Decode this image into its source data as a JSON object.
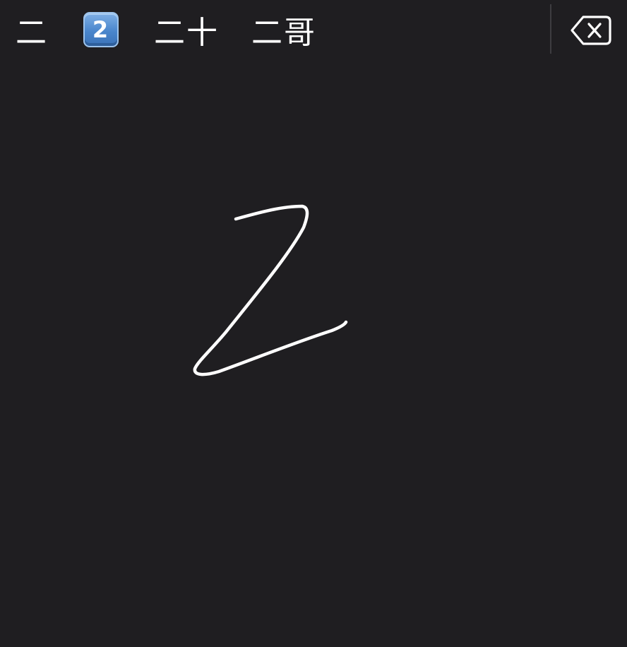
{
  "candidates": [
    {
      "text": "二"
    },
    {
      "text": "2",
      "kind": "keycap-digit-emoji"
    },
    {
      "text": "二十"
    },
    {
      "text": "二哥"
    }
  ],
  "icons": {
    "delete": "backspace-delete-icon"
  },
  "colors": {
    "background": "#1f1e21",
    "ink": "#ffffff",
    "keycap": "#4a86cc",
    "divider": "#3d3c40"
  },
  "handwriting": {
    "stroke_color": "#ffffff",
    "recognized_as": "Z"
  }
}
